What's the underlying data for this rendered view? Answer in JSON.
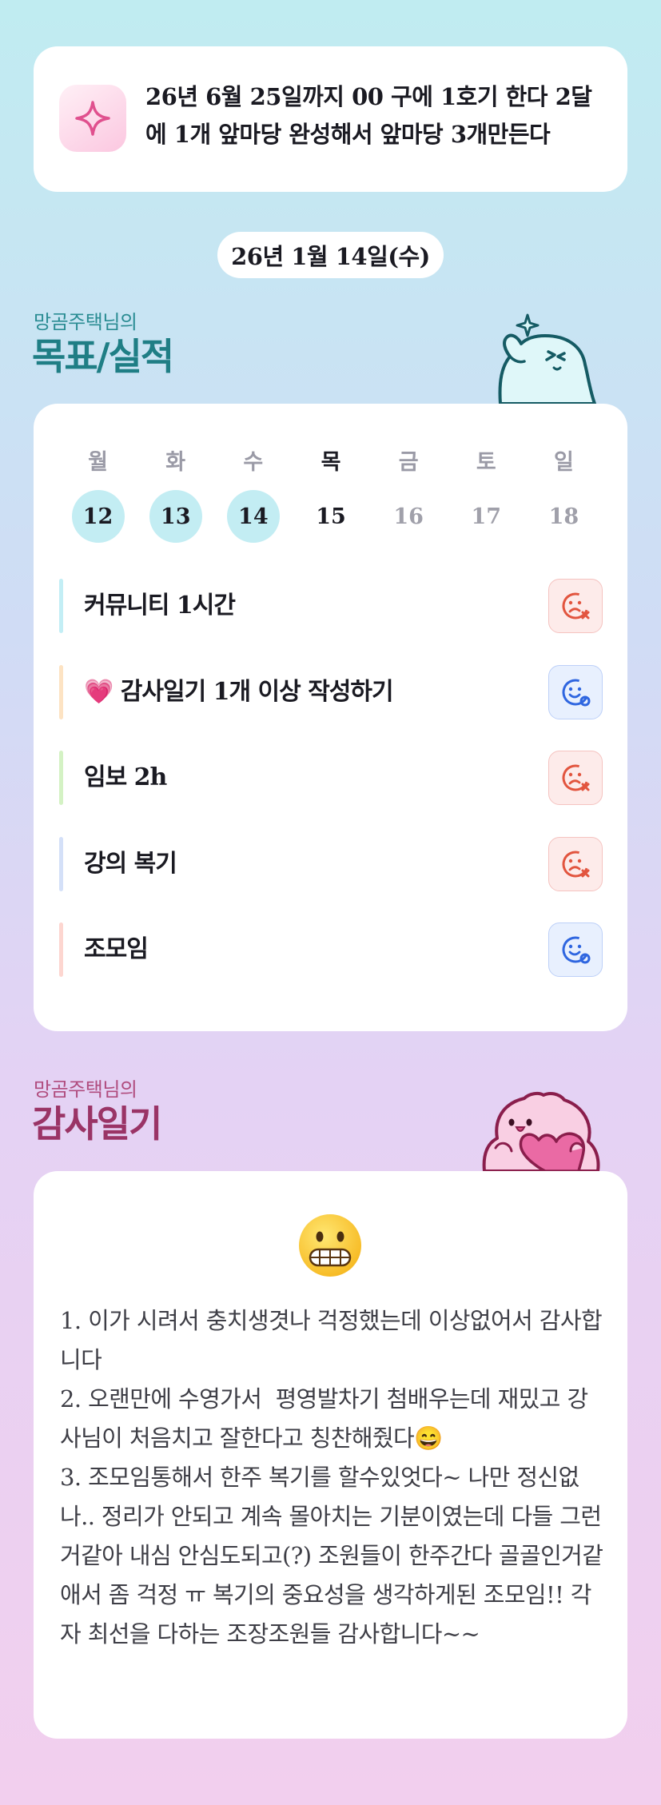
{
  "goal": {
    "icon": "sparkle-icon",
    "text": "26년 6월 25일까지 00 구에 1호기 한다 2달에 1개 앞마당 완성해서 앞마당 3개만든다"
  },
  "date": "26년 1월 14일(수)",
  "goal_section": {
    "subtitle": "망곰주택님의",
    "title": "목표/실적"
  },
  "week": {
    "days": [
      "월",
      "화",
      "수",
      "목",
      "금",
      "토",
      "일"
    ],
    "dates": [
      "12",
      "13",
      "14",
      "15",
      "16",
      "17",
      "18"
    ],
    "done": [
      true,
      true,
      true,
      false,
      false,
      false,
      false
    ],
    "today_index": 3
  },
  "tasks": [
    {
      "label": "커뮤니티 1시간",
      "status": "fail",
      "status_icon": "sad-face-x-icon",
      "bar_color": "#c3eef5"
    },
    {
      "label": "💗 감사일기 1개 이상 작성하기",
      "status": "ok",
      "status_icon": "smile-face-check-icon",
      "bar_color": "#fde3c3"
    },
    {
      "label": "임보 2h",
      "status": "fail",
      "status_icon": "sad-face-x-icon",
      "bar_color": "#d4f2c4"
    },
    {
      "label": "강의 복기",
      "status": "fail",
      "status_icon": "sad-face-x-icon",
      "bar_color": "#d4e0f8"
    },
    {
      "label": "조모임",
      "status": "ok",
      "status_icon": "smile-face-check-icon",
      "bar_color": "#fdd6d0"
    }
  ],
  "diary_section": {
    "subtitle": "망곰주택님의",
    "title": "감사일기"
  },
  "diary": {
    "mood_icon": "grimacing-face-icon",
    "text": "1. 이가 시려서 충치생겻나 걱정했는데 이상없어서 감사합니다\n2. 오랜만에 수영가서  평영발차기 첨배우는데 재밌고 강사님이 처음치고 잘한다고 칭찬해줬다😄\n3. 조모임통해서 한주 복기를 할수있엇다~ 나만 정신없나.. 정리가 안되고 계속 몰아치는 기분이였는데 다들 그런거같아 내심 안심도되고(?) 조원들이 한주간다 골골인거같애서 좀 걱정 ㅠ 복기의 중요성을 생각하게된 조모임!! 각자 최선을 다하는 조장조원들 감사합니다~~"
  },
  "colors": {
    "accent_teal": "#1f7e85",
    "accent_pink": "#9a3466",
    "done_circle": "#c3edf3",
    "fail": "#e2553f",
    "ok": "#2f66e0"
  }
}
